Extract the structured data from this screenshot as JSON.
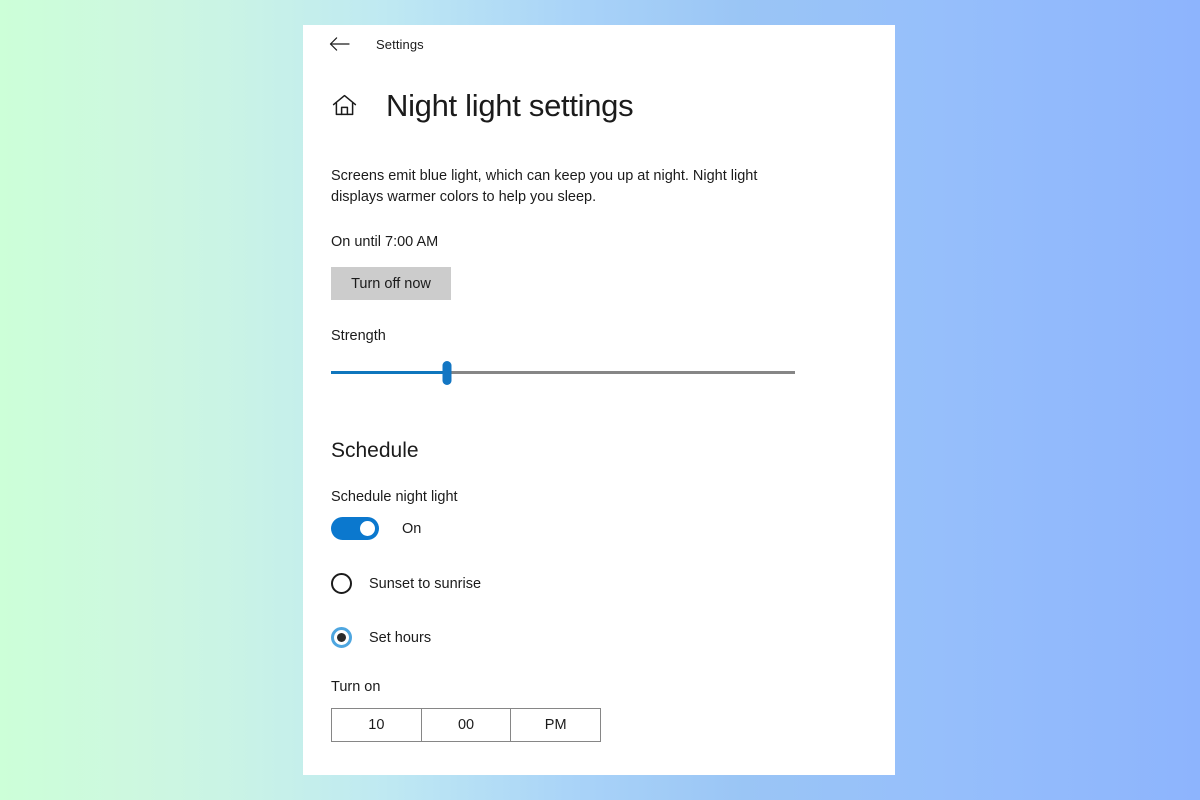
{
  "window": {
    "titlebar": {
      "back_icon": "back-arrow-icon",
      "label": "Settings"
    },
    "header": {
      "home_icon": "home-icon",
      "title": "Night light settings"
    }
  },
  "main": {
    "description": "Screens emit blue light, which can keep you up at night. Night light displays warmer colors to help you sleep.",
    "status_text": "On until 7:00 AM",
    "turn_off_label": "Turn off now",
    "strength": {
      "label": "Strength",
      "value_percent": 25,
      "fill_color": "#0f76bd",
      "track_color": "#868686",
      "thumb_color": "#1376c3"
    }
  },
  "schedule": {
    "heading": "Schedule",
    "toggle": {
      "label": "Schedule night light",
      "state": "On",
      "checked": true,
      "accent_color": "#0b78ce"
    },
    "options": [
      {
        "label": "Sunset to sunrise",
        "selected": false
      },
      {
        "label": "Set hours",
        "selected": true
      }
    ],
    "turn_on": {
      "label": "Turn on",
      "hour": "10",
      "minute": "00",
      "meridiem": "PM"
    }
  }
}
